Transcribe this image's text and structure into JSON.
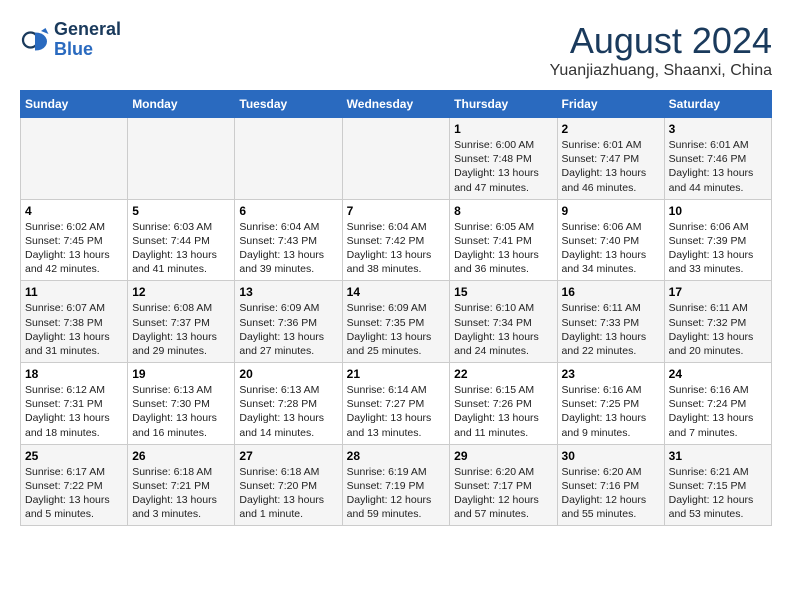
{
  "logo": {
    "line1": "General",
    "line2": "Blue"
  },
  "title": "August 2024",
  "subtitle": "Yuanjiazhuang, Shaanxi, China",
  "days_of_week": [
    "Sunday",
    "Monday",
    "Tuesday",
    "Wednesday",
    "Thursday",
    "Friday",
    "Saturday"
  ],
  "weeks": [
    [
      {
        "day": "",
        "info": ""
      },
      {
        "day": "",
        "info": ""
      },
      {
        "day": "",
        "info": ""
      },
      {
        "day": "",
        "info": ""
      },
      {
        "day": "1",
        "info": "Sunrise: 6:00 AM\nSunset: 7:48 PM\nDaylight: 13 hours and 47 minutes."
      },
      {
        "day": "2",
        "info": "Sunrise: 6:01 AM\nSunset: 7:47 PM\nDaylight: 13 hours and 46 minutes."
      },
      {
        "day": "3",
        "info": "Sunrise: 6:01 AM\nSunset: 7:46 PM\nDaylight: 13 hours and 44 minutes."
      }
    ],
    [
      {
        "day": "4",
        "info": "Sunrise: 6:02 AM\nSunset: 7:45 PM\nDaylight: 13 hours and 42 minutes."
      },
      {
        "day": "5",
        "info": "Sunrise: 6:03 AM\nSunset: 7:44 PM\nDaylight: 13 hours and 41 minutes."
      },
      {
        "day": "6",
        "info": "Sunrise: 6:04 AM\nSunset: 7:43 PM\nDaylight: 13 hours and 39 minutes."
      },
      {
        "day": "7",
        "info": "Sunrise: 6:04 AM\nSunset: 7:42 PM\nDaylight: 13 hours and 38 minutes."
      },
      {
        "day": "8",
        "info": "Sunrise: 6:05 AM\nSunset: 7:41 PM\nDaylight: 13 hours and 36 minutes."
      },
      {
        "day": "9",
        "info": "Sunrise: 6:06 AM\nSunset: 7:40 PM\nDaylight: 13 hours and 34 minutes."
      },
      {
        "day": "10",
        "info": "Sunrise: 6:06 AM\nSunset: 7:39 PM\nDaylight: 13 hours and 33 minutes."
      }
    ],
    [
      {
        "day": "11",
        "info": "Sunrise: 6:07 AM\nSunset: 7:38 PM\nDaylight: 13 hours and 31 minutes."
      },
      {
        "day": "12",
        "info": "Sunrise: 6:08 AM\nSunset: 7:37 PM\nDaylight: 13 hours and 29 minutes."
      },
      {
        "day": "13",
        "info": "Sunrise: 6:09 AM\nSunset: 7:36 PM\nDaylight: 13 hours and 27 minutes."
      },
      {
        "day": "14",
        "info": "Sunrise: 6:09 AM\nSunset: 7:35 PM\nDaylight: 13 hours and 25 minutes."
      },
      {
        "day": "15",
        "info": "Sunrise: 6:10 AM\nSunset: 7:34 PM\nDaylight: 13 hours and 24 minutes."
      },
      {
        "day": "16",
        "info": "Sunrise: 6:11 AM\nSunset: 7:33 PM\nDaylight: 13 hours and 22 minutes."
      },
      {
        "day": "17",
        "info": "Sunrise: 6:11 AM\nSunset: 7:32 PM\nDaylight: 13 hours and 20 minutes."
      }
    ],
    [
      {
        "day": "18",
        "info": "Sunrise: 6:12 AM\nSunset: 7:31 PM\nDaylight: 13 hours and 18 minutes."
      },
      {
        "day": "19",
        "info": "Sunrise: 6:13 AM\nSunset: 7:30 PM\nDaylight: 13 hours and 16 minutes."
      },
      {
        "day": "20",
        "info": "Sunrise: 6:13 AM\nSunset: 7:28 PM\nDaylight: 13 hours and 14 minutes."
      },
      {
        "day": "21",
        "info": "Sunrise: 6:14 AM\nSunset: 7:27 PM\nDaylight: 13 hours and 13 minutes."
      },
      {
        "day": "22",
        "info": "Sunrise: 6:15 AM\nSunset: 7:26 PM\nDaylight: 13 hours and 11 minutes."
      },
      {
        "day": "23",
        "info": "Sunrise: 6:16 AM\nSunset: 7:25 PM\nDaylight: 13 hours and 9 minutes."
      },
      {
        "day": "24",
        "info": "Sunrise: 6:16 AM\nSunset: 7:24 PM\nDaylight: 13 hours and 7 minutes."
      }
    ],
    [
      {
        "day": "25",
        "info": "Sunrise: 6:17 AM\nSunset: 7:22 PM\nDaylight: 13 hours and 5 minutes."
      },
      {
        "day": "26",
        "info": "Sunrise: 6:18 AM\nSunset: 7:21 PM\nDaylight: 13 hours and 3 minutes."
      },
      {
        "day": "27",
        "info": "Sunrise: 6:18 AM\nSunset: 7:20 PM\nDaylight: 13 hours and 1 minute."
      },
      {
        "day": "28",
        "info": "Sunrise: 6:19 AM\nSunset: 7:19 PM\nDaylight: 12 hours and 59 minutes."
      },
      {
        "day": "29",
        "info": "Sunrise: 6:20 AM\nSunset: 7:17 PM\nDaylight: 12 hours and 57 minutes."
      },
      {
        "day": "30",
        "info": "Sunrise: 6:20 AM\nSunset: 7:16 PM\nDaylight: 12 hours and 55 minutes."
      },
      {
        "day": "31",
        "info": "Sunrise: 6:21 AM\nSunset: 7:15 PM\nDaylight: 12 hours and 53 minutes."
      }
    ]
  ]
}
